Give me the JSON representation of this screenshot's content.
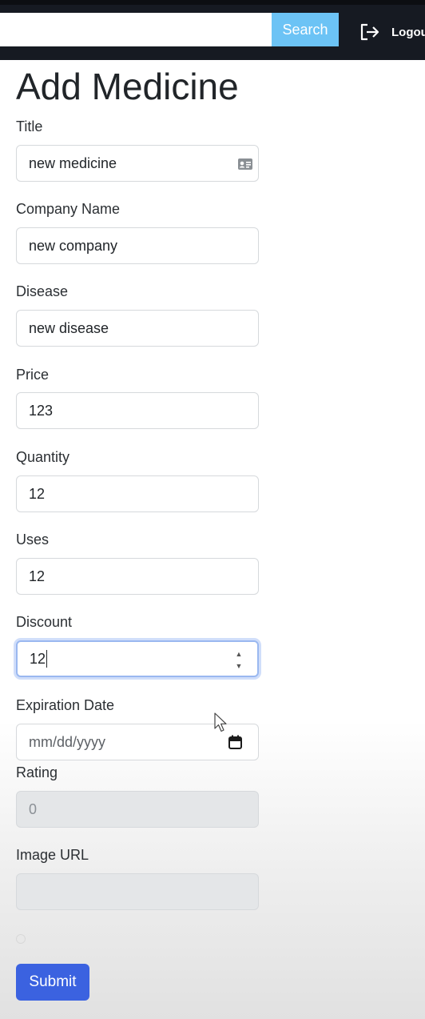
{
  "navbar": {
    "search_value": "",
    "search_button_label": "Search",
    "logout_label": "Logout"
  },
  "page": {
    "title": "Add Medicine"
  },
  "form": {
    "title_label": "Title",
    "title_value": "new medicine",
    "company_label": "Company Name",
    "company_value": "new company",
    "disease_label": "Disease",
    "disease_value": "new disease",
    "price_label": "Price",
    "price_value": "123",
    "quantity_label": "Quantity",
    "quantity_value": "12",
    "uses_label": "Uses",
    "uses_value": "12",
    "discount_label": "Discount",
    "discount_value": "12",
    "expiration_label": "Expiration Date",
    "expiration_placeholder": "mm/dd/yyyy",
    "rating_label": "Rating",
    "rating_value": "0",
    "image_url_label": "Image URL",
    "image_url_value": "",
    "submit_label": "Submit"
  },
  "icons": {
    "logout": "logout-icon",
    "contact_card": "contact-card-icon",
    "calendar": "calendar-icon",
    "spinner": "spinner-arrows-icon",
    "cursor": "mouse-pointer-icon"
  },
  "colors": {
    "navbar_bg": "#161a22",
    "search_button_bg": "#6cc3f5",
    "submit_bg": "#3b62e0",
    "focus_ring": "#9ab8f0"
  }
}
